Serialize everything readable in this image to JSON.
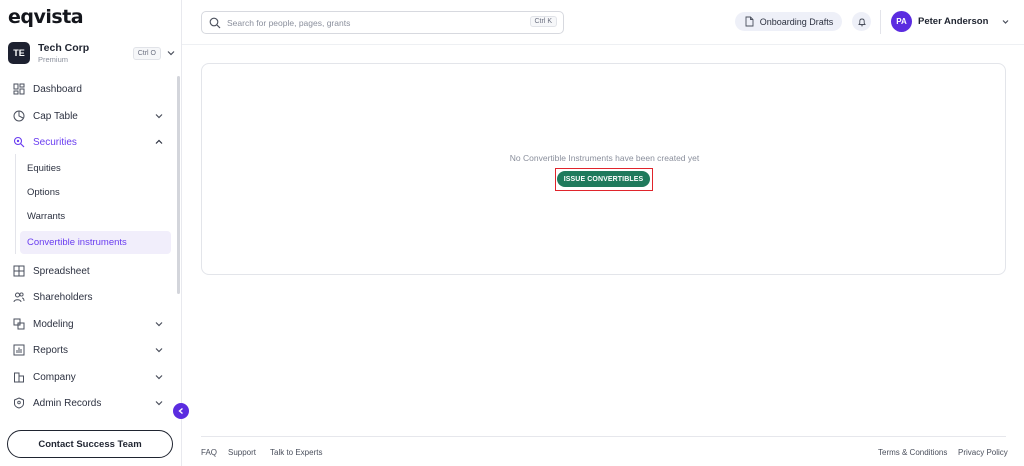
{
  "brand": {
    "logo": "eqvista",
    "accent": "#6a3df0",
    "primary_button": "#1f7a5c"
  },
  "company": {
    "initials": "TE",
    "name": "Tech Corp",
    "plan": "Premium",
    "shortcut": "Ctrl O"
  },
  "sidebar": {
    "items": [
      {
        "label": "Dashboard",
        "icon": "dashboard-icon"
      },
      {
        "label": "Cap Table",
        "icon": "pie-chart-icon"
      },
      {
        "label": "Securities",
        "icon": "securities-icon"
      },
      {
        "label": "Spreadsheet",
        "icon": "grid-icon"
      },
      {
        "label": "Shareholders",
        "icon": "users-icon"
      },
      {
        "label": "Modeling",
        "icon": "modeling-icon"
      },
      {
        "label": "Reports",
        "icon": "reports-icon"
      },
      {
        "label": "Company",
        "icon": "company-icon"
      },
      {
        "label": "Admin Records",
        "icon": "admin-records-icon"
      }
    ],
    "securities_sub": [
      "Equities",
      "Options",
      "Warrants",
      "Convertible instruments"
    ],
    "contact_button": "Contact Success Team"
  },
  "header": {
    "search_placeholder": "Search for people, pages, grants",
    "search_shortcut": "Ctrl K",
    "drafts_label": "Onboarding Drafts",
    "user_initials": "PA",
    "user_name": "Peter Anderson"
  },
  "main": {
    "empty_message": "No Convertible Instruments have been created yet",
    "issue_button": "ISSUE CONVERTIBLES"
  },
  "footer": {
    "left": [
      "FAQ",
      "Support",
      "Talk to Experts"
    ],
    "right": [
      "Terms & Conditions",
      "Privacy Policy"
    ]
  }
}
